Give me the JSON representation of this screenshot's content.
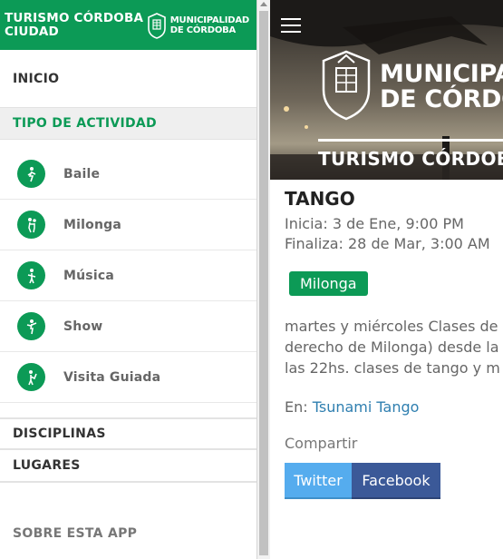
{
  "drawer": {
    "header": {
      "title": "TURISMO CÓRDOBA CIUDAD",
      "logo_line1": "MUNICIPALIDAD",
      "logo_line2": "DE CÓRDOBA"
    },
    "inicio": "INICIO",
    "section_tipo": "TIPO DE ACTIVIDAD",
    "activities": [
      {
        "label": "Baile",
        "icon": "dance-icon"
      },
      {
        "label": "Milonga",
        "icon": "milonga-icon"
      },
      {
        "label": "Música",
        "icon": "music-icon"
      },
      {
        "label": "Show",
        "icon": "show-icon"
      },
      {
        "label": "Visita Guiada",
        "icon": "guided-visit-icon"
      }
    ],
    "disciplinas": "DISCIPLINAS",
    "lugares": "LUGARES",
    "about": "SOBRE ESTA APP"
  },
  "hero": {
    "brand_line1": "MUNICIPALIDAD",
    "brand_line2": "DE CÓRDOBA",
    "subtitle": "TURISMO CÓRDOBA"
  },
  "event": {
    "title": "TANGO",
    "start": "Inicia: 3 de Ene, 9:00 PM",
    "end": "Finaliza: 28 de Mar, 3:00 AM",
    "tag": "Milonga",
    "description_lines": [
      "martes y miércoles Clases de",
      "derecho de Milonga) desde la",
      "las 22hs. clases de tango y m"
    ],
    "venue_prefix": "En:",
    "venue": "Tsunami Tango",
    "share_label": "Compartir",
    "share_twitter": "Twitter",
    "share_facebook": "Facebook"
  },
  "colors": {
    "brand_green": "#0c9a56",
    "twitter_blue": "#55acee",
    "facebook_blue": "#3b5998",
    "link_blue": "#2f7fb0"
  }
}
